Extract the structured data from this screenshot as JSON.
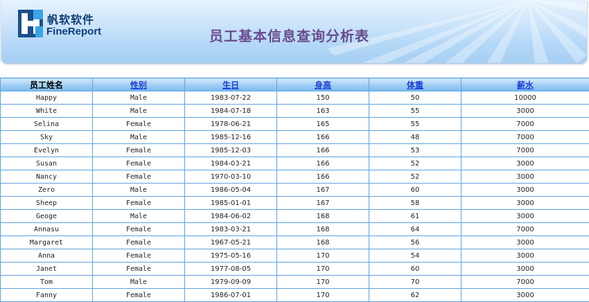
{
  "header": {
    "brand_cn": "帆软软件",
    "brand_en": "FineReport",
    "title": "员工基本信息查询分析表"
  },
  "table": {
    "columns": [
      {
        "label": "员工姓名",
        "sortable": false
      },
      {
        "label": "性别",
        "sortable": true
      },
      {
        "label": "生日",
        "sortable": true
      },
      {
        "label": "身高",
        "sortable": true
      },
      {
        "label": "体重",
        "sortable": true
      },
      {
        "label": "薪水",
        "sortable": true
      }
    ],
    "rows": [
      [
        "Happy",
        "Male",
        "1983-07-22",
        "150",
        "50",
        "10000"
      ],
      [
        "White",
        "Male",
        "1984-07-18",
        "163",
        "55",
        "3000"
      ],
      [
        "Selina",
        "Female",
        "1978-06-21",
        "165",
        "55",
        "7000"
      ],
      [
        "Sky",
        "Male",
        "1985-12-16",
        "166",
        "48",
        "7000"
      ],
      [
        "Evelyn",
        "Female",
        "1985-12-03",
        "166",
        "53",
        "7000"
      ],
      [
        "Susan",
        "Female",
        "1984-03-21",
        "166",
        "52",
        "3000"
      ],
      [
        "Nancy",
        "Female",
        "1970-03-10",
        "166",
        "52",
        "3000"
      ],
      [
        "Zero",
        "Male",
        "1986-05-04",
        "167",
        "60",
        "3000"
      ],
      [
        "Sheep",
        "Female",
        "1985-01-01",
        "167",
        "58",
        "3000"
      ],
      [
        "Geoge",
        "Male",
        "1984-06-02",
        "168",
        "61",
        "3000"
      ],
      [
        "Annasu",
        "Female",
        "1983-03-21",
        "168",
        "64",
        "7000"
      ],
      [
        "Margaret",
        "Female",
        "1967-05-21",
        "168",
        "56",
        "3000"
      ],
      [
        "Anna",
        "Female",
        "1975-05-16",
        "170",
        "54",
        "3000"
      ],
      [
        "Janet",
        "Female",
        "1977-08-05",
        "170",
        "60",
        "3000"
      ],
      [
        "Tom",
        "Male",
        "1979-09-09",
        "170",
        "70",
        "7000"
      ],
      [
        "Fanny",
        "Female",
        "1986-07-01",
        "170",
        "62",
        "3000"
      ]
    ]
  },
  "colors": {
    "header_text": "#6a4b8e",
    "link": "#1c3fd6",
    "grid": "#5ea3e0",
    "brand": "#0d3e7a"
  },
  "icons": {
    "logo": "finereport-logo-icon"
  }
}
